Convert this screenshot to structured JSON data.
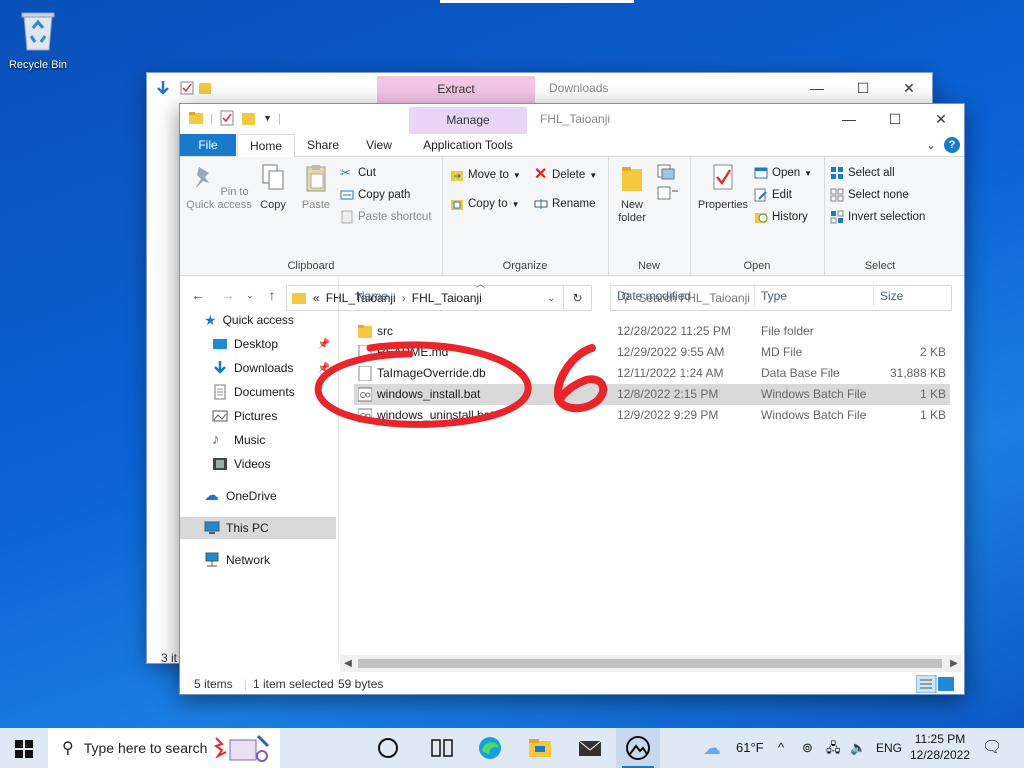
{
  "desktop": {
    "recycle_bin_label": "Recycle Bin"
  },
  "back_window": {
    "context_tab": "Extract",
    "title": "Downloads",
    "status_partial": "3 it"
  },
  "window": {
    "context_tab": "Manage",
    "title": "FHL_Taioanji",
    "tabs": {
      "file": "File",
      "home": "Home",
      "share": "Share",
      "view": "View",
      "app_tools": "Application Tools",
      "help": "?"
    },
    "ribbon": {
      "clipboard": {
        "label": "Clipboard",
        "pin": "Pin to Quick access",
        "copy": "Copy",
        "paste": "Paste",
        "cut": "Cut",
        "copy_path": "Copy path",
        "paste_shortcut": "Paste shortcut"
      },
      "organize": {
        "label": "Organize",
        "move_to": "Move to",
        "copy_to": "Copy to",
        "delete": "Delete",
        "rename": "Rename"
      },
      "new": {
        "label": "New",
        "new_folder": "New folder"
      },
      "open": {
        "label": "Open",
        "properties": "Properties",
        "open": "Open",
        "edit": "Edit",
        "history": "History"
      },
      "select": {
        "label": "Select",
        "select_all": "Select all",
        "select_none": "Select none",
        "invert": "Invert selection"
      }
    },
    "address": {
      "prefix": "«",
      "crumbs": [
        "FHL_Taioanji",
        "FHL_Taioanji"
      ],
      "search_placeholder": "Search FHL_Taioanji"
    },
    "nav": {
      "quick_access": "Quick access",
      "items": [
        "Desktop",
        "Downloads",
        "Documents",
        "Pictures",
        "Music",
        "Videos"
      ],
      "onedrive": "OneDrive",
      "this_pc": "This PC",
      "network": "Network"
    },
    "columns": {
      "name": "Name",
      "date": "Date modified",
      "type": "Type",
      "size": "Size"
    },
    "files": [
      {
        "name": "src",
        "date": "12/28/2022 11:25 PM",
        "type": "File folder",
        "size": "",
        "icon": "folder-icon"
      },
      {
        "name": "README.md",
        "date": "12/29/2022 9:55 AM",
        "type": "MD File",
        "size": "2 KB",
        "icon": "document-icon"
      },
      {
        "name": "TaImageOverride.db",
        "date": "12/11/2022 1:24 AM",
        "type": "Data Base File",
        "size": "31,888 KB",
        "icon": "document-icon"
      },
      {
        "name": "windows_install.bat",
        "date": "12/8/2022 2:15 PM",
        "type": "Windows Batch File",
        "size": "1 KB",
        "icon": "batch-file-icon",
        "selected": true
      },
      {
        "name": "windows_uninstall.bat",
        "date": "12/9/2022 9:29 PM",
        "type": "Windows Batch File",
        "size": "1 KB",
        "icon": "batch-file-icon"
      }
    ],
    "status": {
      "count": "5 items",
      "selected": "1 item selected",
      "bytes": "59 bytes"
    }
  },
  "annotation": {
    "digit": "6",
    "color": "#e8252a"
  },
  "taskbar": {
    "search_placeholder": "Type here to search",
    "weather": "61°F",
    "language": "ENG",
    "time": "11:25 PM",
    "date": "12/28/2022"
  }
}
